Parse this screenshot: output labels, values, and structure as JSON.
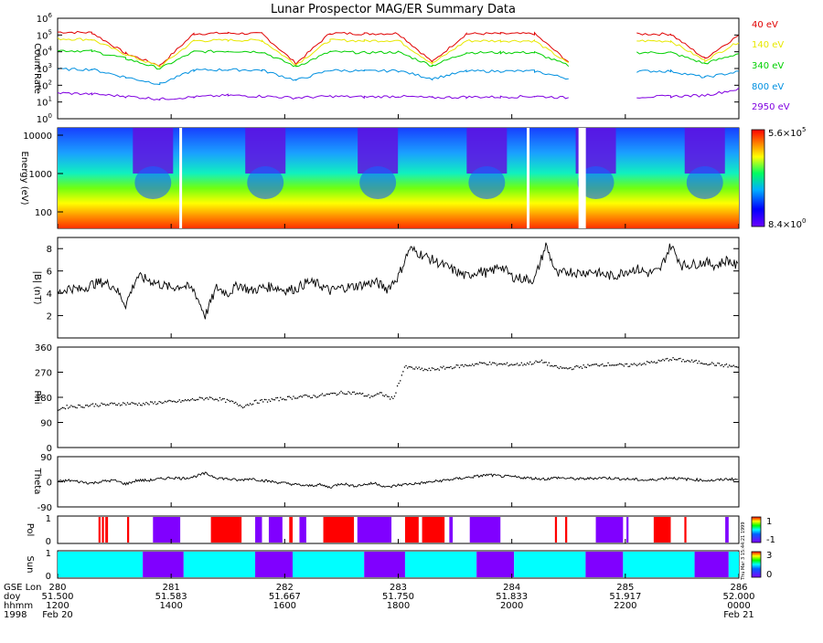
{
  "title": "Lunar Prospector MAG/ER Summary Data",
  "colors": {
    "40 eV": "#e00000",
    "140 eV": "#e8e800",
    "340 eV": "#00d000",
    "800 eV": "#0090e0",
    "2950 eV": "#8000e0"
  },
  "chart_data": [
    {
      "type": "line",
      "panel": "count-rate",
      "ylabel": "Count Rate",
      "yscale": "log",
      "ylim": [
        1,
        1000000
      ],
      "y_ticks": [
        "10^0",
        "10^1",
        "10^2",
        "10^3",
        "10^4",
        "10^5",
        "10^6"
      ],
      "series": [
        {
          "name": "40 eV",
          "values": [
            150000,
            140000,
            8000,
            1500,
            120000,
            130000,
            120000,
            2000,
            130000,
            120000,
            125000,
            2500,
            120000,
            120000,
            120000,
            2500,
            null,
            115000,
            115000,
            4000,
            100000
          ]
        },
        {
          "name": "140 eV",
          "values": [
            60000,
            55000,
            7000,
            1300,
            45000,
            50000,
            48000,
            1700,
            50000,
            45000,
            48000,
            2000,
            45000,
            45000,
            45000,
            2000,
            null,
            45000,
            44000,
            3000,
            40000
          ]
        },
        {
          "name": "340 eV",
          "values": [
            12000,
            11000,
            4000,
            1000,
            10000,
            11000,
            10000,
            1300,
            10000,
            9000,
            9500,
            1500,
            9000,
            9000,
            9000,
            1500,
            null,
            9000,
            9000,
            2000,
            8000
          ]
        },
        {
          "name": "800 eV",
          "values": [
            900,
            900,
            300,
            120,
            800,
            850,
            800,
            200,
            800,
            700,
            750,
            250,
            700,
            700,
            700,
            250,
            null,
            700,
            700,
            300,
            650
          ]
        },
        {
          "name": "2950 eV",
          "values": [
            35,
            30,
            22,
            15,
            20,
            25,
            22,
            18,
            22,
            20,
            22,
            18,
            20,
            20,
            22,
            18,
            null,
            20,
            22,
            25,
            60
          ]
        }
      ]
    },
    {
      "type": "heatmap",
      "panel": "energy-spectrogram",
      "ylabel": "Energy (eV)",
      "yscale": "log",
      "y_ticks": [
        "100",
        "1000",
        "10000"
      ],
      "colorbar": {
        "max": "5.6×10^5",
        "min": "8.4×10^0"
      },
      "data_gaps_at_x": [
        0.18,
        0.69,
        0.77
      ]
    },
    {
      "type": "line",
      "panel": "field-magnitude",
      "ylabel": "|B| (nT)",
      "ylim": [
        0,
        9
      ],
      "y_ticks": [
        2,
        4,
        6,
        8
      ],
      "series": [
        {
          "values": [
            4.0,
            4.5,
            4.3,
            4.8,
            5.0,
            4.6,
            3.0,
            5.5,
            5.2,
            4.8,
            4.5,
            4.7,
            4.3,
            2.0,
            4.5,
            4.0,
            4.8,
            4.2,
            4.5,
            4.6,
            4.3,
            4.4,
            5.0,
            4.8,
            4.2,
            4.5,
            4.6,
            4.8,
            5.0,
            4.4,
            5.5,
            8.0,
            7.5,
            7.0,
            6.5,
            6.0,
            5.5,
            6.0,
            5.8,
            6.5,
            5.5,
            5.3,
            5.2,
            8.3,
            5.6,
            6.0,
            5.8,
            6.0,
            5.7,
            5.5,
            6.0,
            6.2,
            5.8,
            6.0,
            8.3,
            6.5,
            6.6,
            6.8,
            6.5,
            7.0,
            6.3
          ]
        }
      ]
    },
    {
      "type": "scatter",
      "panel": "phi",
      "ylabel": "Phi",
      "ylim": [
        0,
        360
      ],
      "y_ticks": [
        0,
        90,
        180,
        270,
        360
      ],
      "series": [
        {
          "values": [
            140,
            150,
            150,
            155,
            155,
            158,
            160,
            158,
            160,
            165,
            165,
            170,
            175,
            180,
            175,
            165,
            150,
            165,
            170,
            175,
            180,
            185,
            185,
            190,
            195,
            200,
            195,
            185,
            195,
            175,
            290,
            285,
            280,
            285,
            290,
            295,
            300,
            305,
            300,
            300,
            300,
            305,
            310,
            290,
            285,
            290,
            295,
            300,
            300,
            295,
            300,
            305,
            310,
            320,
            315,
            310,
            305,
            300,
            295,
            290
          ]
        }
      ]
    },
    {
      "type": "line",
      "panel": "theta",
      "ylabel": "Theta",
      "ylim": [
        -90,
        90
      ],
      "y_ticks": [
        -90,
        0,
        90
      ],
      "series": [
        {
          "values": [
            0,
            5,
            0,
            -5,
            2,
            5,
            -8,
            5,
            5,
            10,
            15,
            12,
            18,
            30,
            15,
            10,
            5,
            12,
            5,
            0,
            -5,
            -10,
            -15,
            -10,
            -20,
            -5,
            -15,
            -10,
            -5,
            -20,
            -12,
            -8,
            -5,
            0,
            5,
            10,
            15,
            20,
            25,
            20,
            18,
            15,
            12,
            10,
            15,
            12,
            10,
            12,
            15,
            12,
            10,
            8,
            5,
            10,
            15,
            10,
            8,
            5,
            5,
            10,
            8
          ]
        }
      ]
    },
    {
      "type": "heatmap",
      "panel": "pol",
      "ylabel": "Pol",
      "y_ticks": [
        "0",
        "1"
      ],
      "colorbar": {
        "ticks": [
          "1",
          "-1"
        ]
      }
    },
    {
      "type": "heatmap",
      "panel": "sun",
      "ylabel": "Sun",
      "y_ticks": [
        "0",
        "1"
      ],
      "colorbar": {
        "ticks": [
          "3",
          "0"
        ]
      },
      "side_label": "Thu Mar 3 15:44:21 1999"
    }
  ],
  "axis_labels": [
    {
      "label": "GSE Lon",
      "values": [
        "280",
        "281",
        "282",
        "283",
        "284",
        "285",
        "286"
      ]
    },
    {
      "label": "doy",
      "values": [
        "51.500",
        "51.583",
        "51.667",
        "51.750",
        "51.833",
        "51.917",
        "52.000"
      ]
    },
    {
      "label": "hhmm",
      "values": [
        "1200",
        "1400",
        "1600",
        "1800",
        "2000",
        "2200",
        "0000"
      ]
    },
    {
      "label": "1998",
      "values": [
        "Feb 20",
        "",
        "",
        "",
        "",
        "",
        "Feb 21"
      ]
    }
  ],
  "right_labels": [
    "40 eV",
    "140 eV",
    "340 eV",
    "800 eV",
    "2950 eV"
  ],
  "spectrogram_colorbar": {
    "max_label": "5.6×10",
    "max_exp": "5",
    "min_label": "8.4×10",
    "min_exp": "0"
  }
}
